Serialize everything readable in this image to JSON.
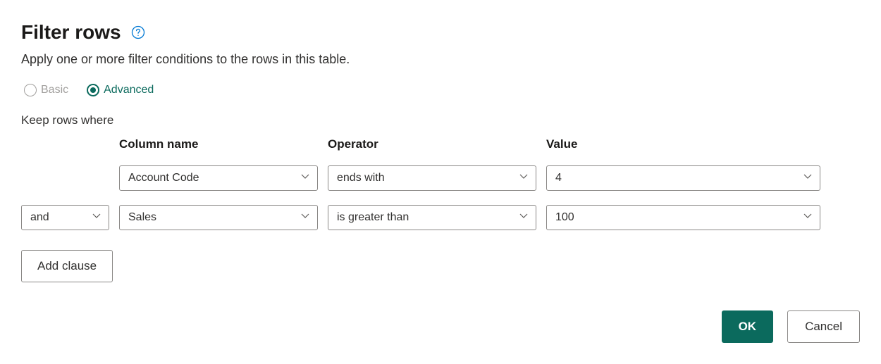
{
  "header": {
    "title": "Filter rows",
    "subtitle": "Apply one or more filter conditions to the rows in this table."
  },
  "mode": {
    "basic_label": "Basic",
    "advanced_label": "Advanced",
    "selected": "advanced"
  },
  "keep_label": "Keep rows where",
  "columns": {
    "column_name": "Column name",
    "operator": "Operator",
    "value": "Value"
  },
  "clauses": [
    {
      "conjunction": null,
      "column": "Account Code",
      "operator": "ends with",
      "value": "4"
    },
    {
      "conjunction": "and",
      "column": "Sales",
      "operator": "is greater than",
      "value": "100"
    }
  ],
  "buttons": {
    "add_clause": "Add clause",
    "ok": "OK",
    "cancel": "Cancel"
  },
  "colors": {
    "accent": "#0b6a5d",
    "help": "#0078d4"
  }
}
